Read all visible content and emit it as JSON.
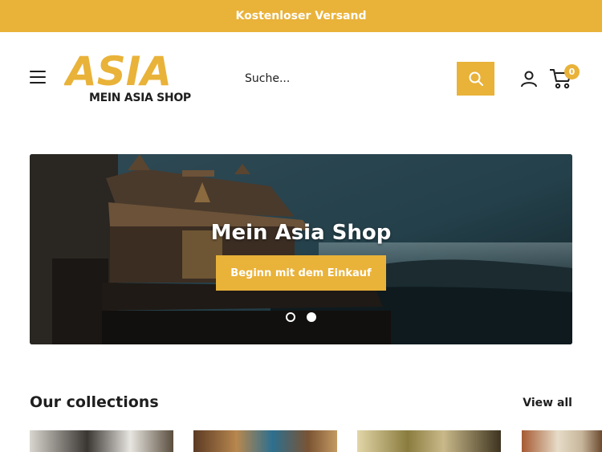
{
  "announcement": "Kostenloser Versand",
  "logo": {
    "word": "ASIA",
    "tagline": "MEIN ASIA SHOP",
    "color": "#e9b239"
  },
  "search": {
    "placeholder": "Suche..."
  },
  "cart": {
    "count": "0"
  },
  "hero": {
    "title": "Mein Asia Shop",
    "cta_label": "Beginn mit dem Einkauf",
    "slides": 2,
    "active_slide": 2
  },
  "collections": {
    "title": "Our collections",
    "view_all_label": "View all"
  },
  "icons": {
    "menu": "hamburger-icon",
    "search": "search-icon",
    "account": "user-icon",
    "cart": "cart-icon"
  },
  "colors": {
    "accent": "#e9b239",
    "text": "#1e1e1e",
    "background": "#ffffff"
  }
}
